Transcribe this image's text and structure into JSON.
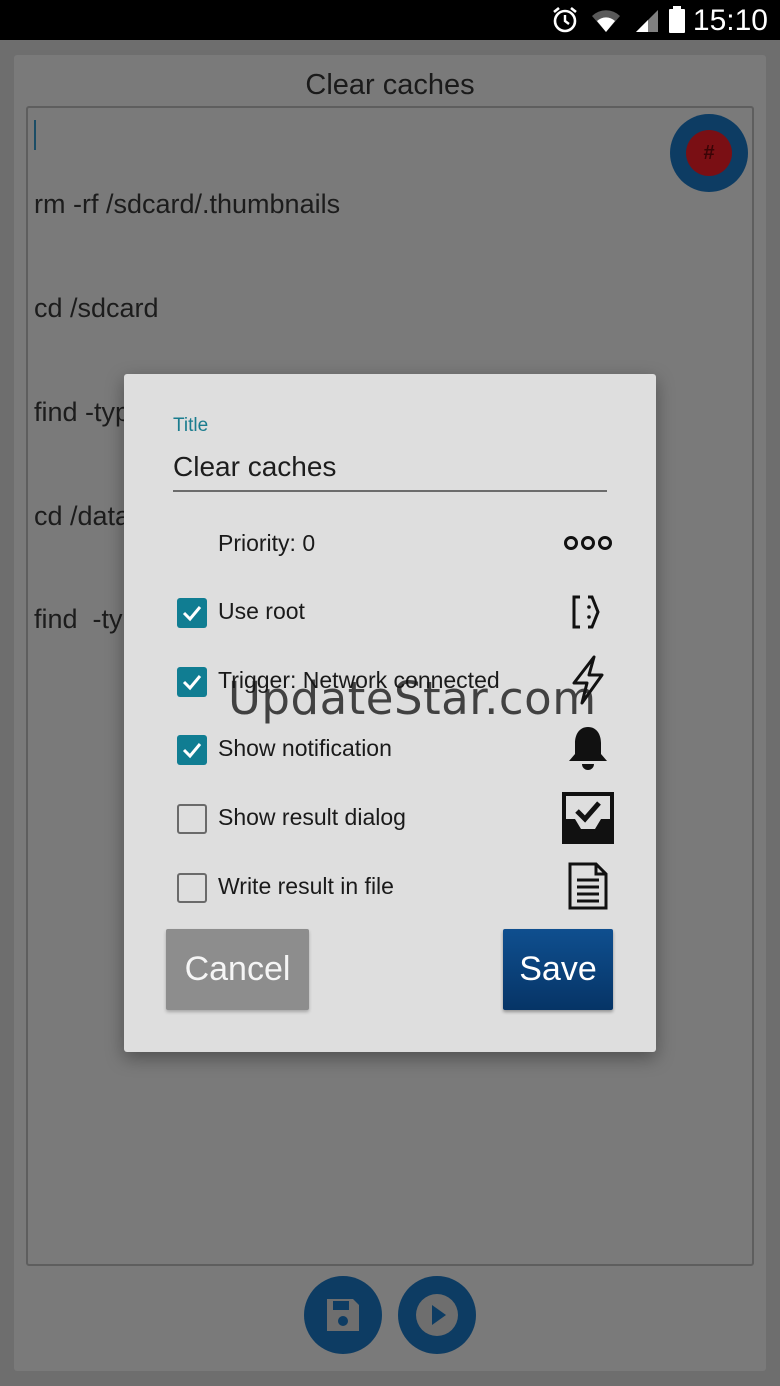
{
  "status_bar": {
    "time": "15:10",
    "icons": [
      "alarm-icon",
      "wifi-icon",
      "signal-icon",
      "battery-icon"
    ]
  },
  "screen": {
    "title": "Clear caches",
    "script_lines": [
      "rm -rf /sdcard/.thumbnails",
      "cd /sdcard",
      "find -type d -name cache -prune -exec rm -rf {} \\;",
      "cd /data/data",
      "find  -type d -name cache -prune -exec rm -rf {} \\;"
    ],
    "fab_top_icon": "hash-icon",
    "bottom_actions": [
      "save-icon",
      "play-icon"
    ]
  },
  "dialog": {
    "title_label": "Title",
    "title_value": "Clear caches",
    "priority": "Priority: 0",
    "options": [
      {
        "label": "Use root",
        "checked": true,
        "icon": "root-bracket-icon"
      },
      {
        "label": "Trigger: Network connected",
        "checked": true,
        "icon": "lightning-icon"
      },
      {
        "label": "Show notification",
        "checked": true,
        "icon": "bell-icon"
      },
      {
        "label": "Show result dialog",
        "checked": false,
        "icon": "dialog-check-icon"
      },
      {
        "label": "Write result in file",
        "checked": false,
        "icon": "document-icon"
      }
    ],
    "cancel_label": "Cancel",
    "save_label": "Save"
  },
  "watermark": "UpdateStar.com",
  "colors": {
    "accent": "#107d92",
    "primary": "#0d3c63",
    "save_button": "#0a4380"
  }
}
